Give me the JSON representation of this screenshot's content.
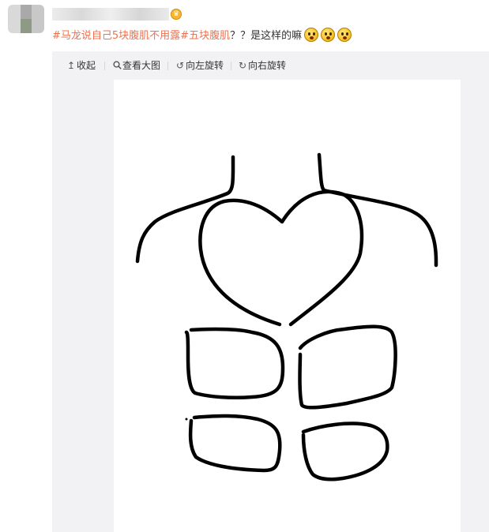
{
  "post": {
    "text_segments": [
      {
        "text": "#马龙说自己5块腹肌不用露#",
        "kind": "topic"
      },
      {
        "text": "五块腹肌",
        "kind": "topic"
      },
      {
        "text": "？？是这样的嘛",
        "kind": "plain"
      }
    ],
    "emoji_names": [
      "doge-emoji",
      "doge-emoji",
      "doge-emoji"
    ],
    "vip_badge_symbol": "♛"
  },
  "toolbar": {
    "collapse": {
      "icon": "↥",
      "label": "收起"
    },
    "view_large": {
      "icon": "🔍︎",
      "label": "查看大图"
    },
    "rotate_left": {
      "icon": "↺",
      "label": "向左旋转"
    },
    "rotate_right": {
      "icon": "↻",
      "label": "向右旋转"
    }
  },
  "colors": {
    "topic": "#eb7350",
    "text": "#333333",
    "panel_bg": "#f2f2f5",
    "drawing_stroke": "#000000"
  },
  "image": {
    "subject": "hand-drawn torso with heart chest and five abdominal blocks",
    "icon": "doodle-image"
  }
}
